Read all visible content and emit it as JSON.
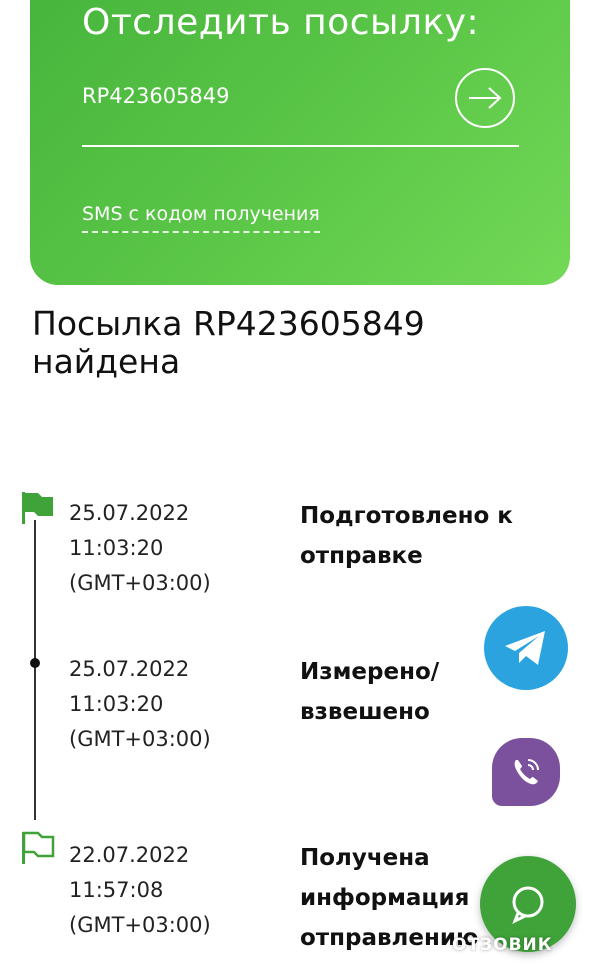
{
  "track": {
    "title": "Отследить посылку:",
    "input_value": "RP423605849",
    "sms_link": "SMS с кодом получения"
  },
  "result": {
    "line1": "Посылка RP423605849",
    "line2": "найдена"
  },
  "events": [
    {
      "date": "25.07.2022",
      "time": "11:03:20",
      "tz": "(GMT+03:00)",
      "status_line1": "Подготовлено к",
      "status_line2": "отправке",
      "status_line3": "",
      "marker": "flag-filled-icon"
    },
    {
      "date": "25.07.2022",
      "time": "11:03:20",
      "tz": "(GMT+03:00)",
      "status_line1": "Измерено/",
      "status_line2": "взвешено",
      "status_line3": "",
      "marker": "dot-icon"
    },
    {
      "date": "22.07.2022",
      "time": "11:57:08",
      "tz": "(GMT+03:00)",
      "status_line1": "Получена",
      "status_line2": "информация",
      "status_line3": "отправлению",
      "marker": "flag-outline-icon"
    }
  ],
  "watermark": "ОТЗОВИК",
  "colors": {
    "green": "#5cc748",
    "telegram": "#2aa3df",
    "viber": "#7b519d",
    "chat_fab": "#3fa33a"
  }
}
